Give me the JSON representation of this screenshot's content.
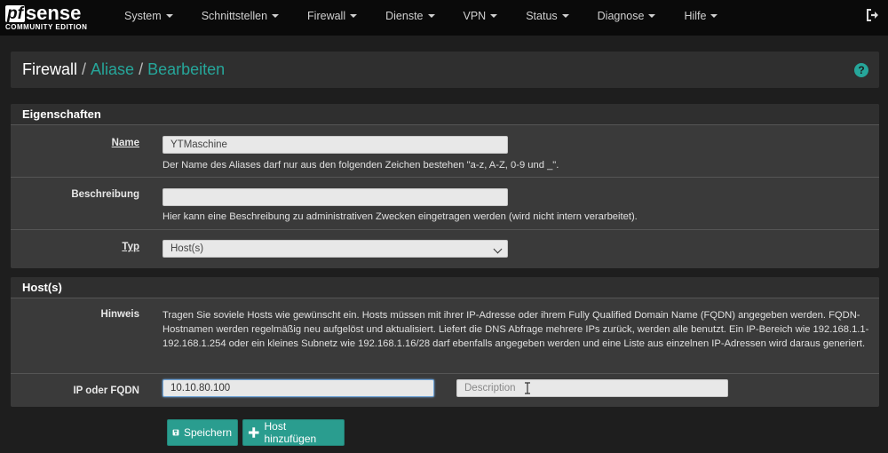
{
  "brand": {
    "name_pf": "pf",
    "name_sense": "sense",
    "edition": "COMMUNITY EDITION"
  },
  "nav": [
    "System",
    "Schnittstellen",
    "Firewall",
    "Dienste",
    "VPN",
    "Status",
    "Diagnose",
    "Hilfe"
  ],
  "breadcrumb": {
    "first": "Firewall",
    "second": "Aliase",
    "third": "Bearbeiten",
    "sep": "/"
  },
  "panels": {
    "properties": {
      "title": "Eigenschaften",
      "name_label": "Name",
      "name_value": "YTMaschine",
      "name_help": "Der Name des Aliases darf nur aus den folgenden Zeichen bestehen \"a-z, A-Z, 0-9 und _\".",
      "desc_label": "Beschreibung",
      "desc_value": "",
      "desc_help": "Hier kann eine Beschreibung zu administrativen Zwecken eingetragen werden (wird nicht intern verarbeitet).",
      "type_label": "Typ",
      "type_value": "Host(s)"
    },
    "hosts": {
      "title": "Host(s)",
      "hint_label": "Hinweis",
      "hint_text": "Tragen Sie soviele Hosts wie gewünscht ein. Hosts müssen mit ihrer IP-Adresse oder ihrem Fully Qualified Domain Name (FQDN) angegeben werden. FQDN-Hostnamen werden regelmäßig neu aufgelöst und aktualisiert. Liefert die DNS Abfrage mehrere IPs zurück, werden alle benutzt. Ein IP-Bereich wie 192.168.1.1-192.168.1.254 oder ein kleines Subnetz wie 192.168.1.16/28 darf ebenfalls angegeben werden und eine Liste aus einzelnen IP-Adressen wird daraus generiert.",
      "ip_label": "IP oder FQDN",
      "ip_value": "10.10.80.100",
      "description_placeholder": "Description"
    }
  },
  "buttons": {
    "save": "Speichern",
    "add_host": "Host hinzufügen"
  },
  "colors": {
    "accent": "#26a69a",
    "button": "#2a9d8f",
    "navbar": "#0a0a0a",
    "panel": "#3a3a3a"
  }
}
